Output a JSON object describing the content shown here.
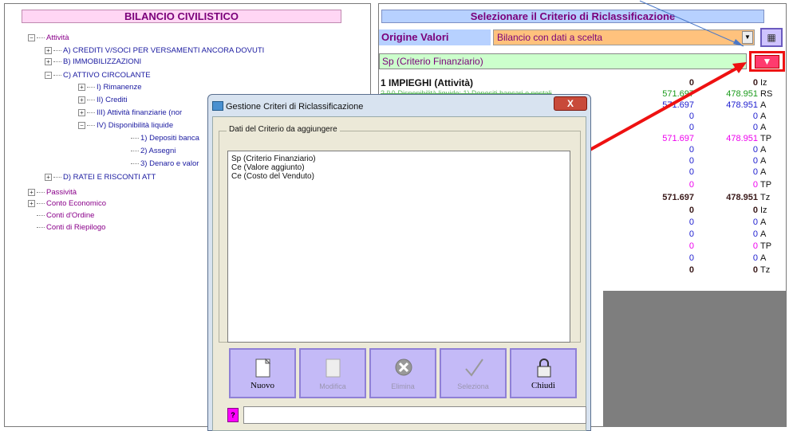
{
  "left_panel": {
    "title": "BILANCIO CIVILISTICO",
    "tree": [
      {
        "label": "Attività",
        "sign": "−",
        "color": "purple"
      },
      {
        "label": "A) CREDITI V/SOCI PER VERSAMENTI ANCORA DOVUTI",
        "sign": "+",
        "color": "blue"
      },
      {
        "label": "B) IMMOBILIZZAZIONI",
        "sign": "+",
        "color": "blue"
      },
      {
        "label": "C) ATTIVO CIRCOLANTE",
        "sign": "−",
        "color": "blue"
      },
      {
        "label": "I) Rimanenze",
        "sign": "+",
        "color": "blue"
      },
      {
        "label": "II) Crediti",
        "sign": "+",
        "color": "blue"
      },
      {
        "label": "III) Attività finanziarie (nor",
        "sign": "+",
        "color": "blue"
      },
      {
        "label": "IV) Disponibilità liquide",
        "sign": "−",
        "color": "blue"
      },
      {
        "label": "1) Depositi banca",
        "sign": "",
        "color": "blue"
      },
      {
        "label": "2) Assegni",
        "sign": "",
        "color": "blue"
      },
      {
        "label": "3) Denaro e valor",
        "sign": "",
        "color": "blue"
      },
      {
        "label": "D) RATEI E RISCONTI ATT",
        "sign": "+",
        "color": "blue"
      },
      {
        "label": "Passività",
        "sign": "+",
        "color": "purple"
      },
      {
        "label": "Conto Economico",
        "sign": "+",
        "color": "purple"
      },
      {
        "label": "Conti d'Ordine",
        "sign": "",
        "color": "purple"
      },
      {
        "label": "Conti di Riepilogo",
        "sign": "",
        "color": "purple"
      }
    ]
  },
  "right_panel": {
    "title": "Selezionare il Criterio di Riclassificazione",
    "origine_label": "Origine Valori",
    "origine_value": "Bilancio con dati a scelta",
    "criterio_value": "Sp (Criterio Finanziario)",
    "header_row": "1  IMPIEGHI (Attività)",
    "row2_text": "2      IV) Disponibilità liquide: 1) Depositi bancari e postali",
    "rows": [
      {
        "v1": "0",
        "v2": "0",
        "suffix": "Iz",
        "style": "dark"
      },
      {
        "v1": "571.697",
        "v2": "478.951",
        "suffix": "RS",
        "style": "green"
      },
      {
        "v1": "571.697",
        "v2": "478.951",
        "suffix": "A",
        "style": "blue"
      },
      {
        "v1": "0",
        "v2": "0",
        "suffix": "A",
        "style": "blue"
      },
      {
        "v1": "0",
        "v2": "0",
        "suffix": "A",
        "style": "blue"
      },
      {
        "v1": "571.697",
        "v2": "478.951",
        "suffix": "TP",
        "style": "magenta"
      },
      {
        "v1": "0",
        "v2": "0",
        "suffix": "A",
        "style": "blue"
      },
      {
        "v1": "0",
        "v2": "0",
        "suffix": "A",
        "style": "blue"
      },
      {
        "v1": "0",
        "v2": "0",
        "suffix": "A",
        "style": "blue"
      },
      {
        "v1": "0",
        "v2": "0",
        "suffix": "TP",
        "style": "magenta"
      },
      {
        "v1": "571.697",
        "v2": "478.951",
        "suffix": "Tz",
        "style": "dark"
      },
      {
        "v1": "0",
        "v2": "0",
        "suffix": "Iz",
        "style": "dark"
      },
      {
        "v1": "0",
        "v2": "0",
        "suffix": "A",
        "style": "blue"
      },
      {
        "v1": "0",
        "v2": "0",
        "suffix": "A",
        "style": "blue"
      },
      {
        "v1": "0",
        "v2": "0",
        "suffix": "TP",
        "style": "magenta"
      },
      {
        "v1": "0",
        "v2": "0",
        "suffix": "A",
        "style": "blue"
      },
      {
        "v1": "0",
        "v2": "0",
        "suffix": "Tz",
        "style": "dark"
      }
    ]
  },
  "dialog": {
    "title": "Gestione Criteri di Riclassificazione",
    "close": "X",
    "group_label": "Dati del Criterio da aggiungere",
    "list_items": [
      "Sp (Criterio Finanziario)",
      "Ce (Valore aggiunto)",
      "Ce (Costo del Venduto)"
    ],
    "buttons": [
      {
        "label": "Nuovo",
        "enabled": true
      },
      {
        "label": "Modifica",
        "enabled": false
      },
      {
        "label": "Elimina",
        "enabled": false
      },
      {
        "label": "Seleziona",
        "enabled": false
      },
      {
        "label": "Chiudi",
        "enabled": true
      }
    ],
    "help_label": "?"
  },
  "colors": {
    "title_pink": "#ffd6f4",
    "title_blue": "#b7d1ff",
    "annotation_red": "#ee1111",
    "button_lavender": "#c4baf7"
  }
}
